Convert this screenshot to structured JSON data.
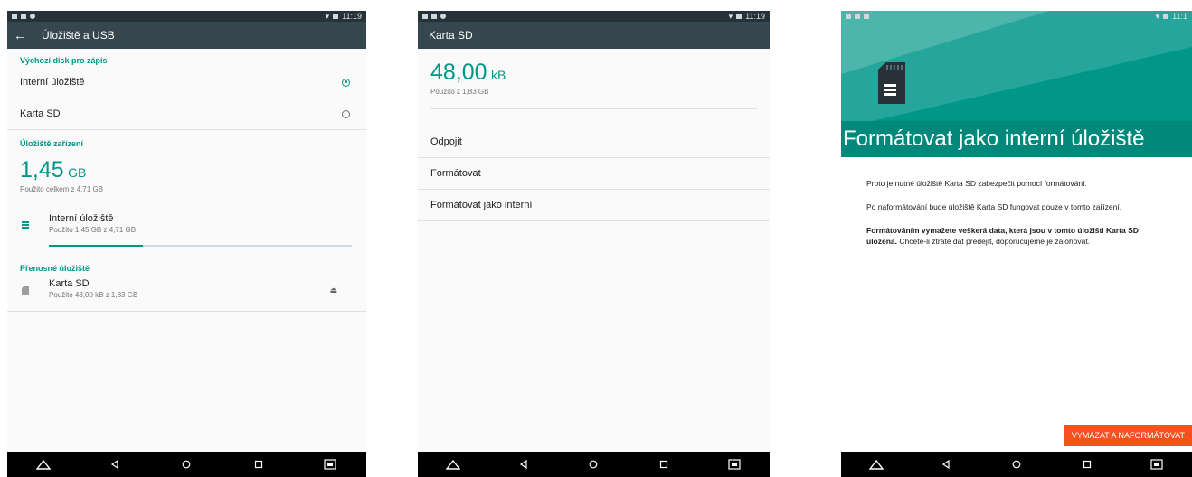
{
  "status": {
    "time": "11:19",
    "time_short": "11:1"
  },
  "screen1": {
    "title": "Úložiště a USB",
    "default_disk_header": "Výchozí disk pro zápis",
    "options": [
      {
        "label": "Interní úložiště",
        "selected": true
      },
      {
        "label": "Karta SD",
        "selected": false
      }
    ],
    "device_storage_header": "Úložiště zařízení",
    "total_value": "1,45",
    "total_unit": "GB",
    "total_sub": "Použito celkem z 4,71 GB",
    "internal": {
      "name": "Interní úložiště",
      "detail": "Použito 1,45 GB z 4,71 GB",
      "progress": 0.31
    },
    "portable_header": "Přenosné úložiště",
    "sd": {
      "name": "Karta SD",
      "detail": "Použito 48,00 kB z 1,83 GB"
    }
  },
  "screen2": {
    "title": "Karta SD",
    "used_value": "48,00",
    "used_unit": "kB",
    "used_sub": "Použito z 1,83 GB",
    "menu": [
      "Odpojit",
      "Formátovat",
      "Formátovat jako interní"
    ]
  },
  "screen3": {
    "heading": "Formátovat jako interní úložiště",
    "p1": "Proto je nutné úložiště Karta SD zabezpečit pomocí formátování.",
    "p2": "Po naformátování bude úložiště Karta SD fungovat pouze v tomto zařízení.",
    "p3_bold": "Formátováním vymažete veškerá data, která jsou v tomto úložišti Karta SD uložena.",
    "p3_rest": " Chcete-li ztrátě dat předejít, doporučujeme je zálohovat.",
    "button": "VYMAZAT A NAFORMÁTOVAT"
  },
  "colors": {
    "accent": "#009688",
    "toolbar": "#37474f",
    "status": "#263238",
    "button": "#f4511e"
  },
  "icons": [
    "back-arrow-icon",
    "radio-icon",
    "storage-icon",
    "sd-card-icon",
    "eject-icon",
    "home-icon",
    "back-icon",
    "recents-icon",
    "screenshot-icon",
    "wifi-icon",
    "battery-icon"
  ]
}
